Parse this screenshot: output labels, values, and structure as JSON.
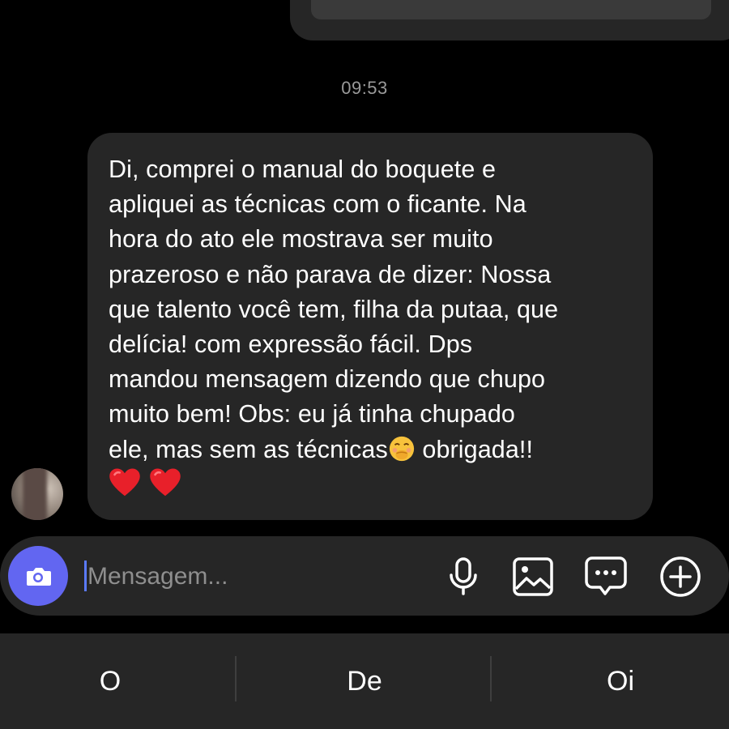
{
  "previous_message": {
    "visible_fragment": "..."
  },
  "timestamp": "09:53",
  "received_message": {
    "lines": [
      "Di, comprei o manual do boquete e",
      "apliquei as técnicas com o ficante. Na",
      "hora do ato ele mostrava ser muito",
      "prazeroso e não parava de dizer: Nossa",
      "que talento você tem, filha da putaa, que",
      "delícia!  com expressão fácil. Dps",
      "mandou mensagem dizendo que chupo",
      "muito bem! Obs: eu já tinha chupado"
    ],
    "last_line_before_emoji": "ele, mas sem as técnicas",
    "last_line_after_emoji": " obrigada!!",
    "emoji": "face-with-hand-over-mouth",
    "hearts": [
      "red-heart",
      "red-heart"
    ]
  },
  "composer": {
    "placeholder": "Mensagem...",
    "value": ""
  },
  "suggestions": [
    "O",
    "De",
    "Oi"
  ],
  "colors": {
    "background": "#000000",
    "bubble": "#262626",
    "accent": "#6266f1",
    "caret": "#5b7bff",
    "timestamp": "#9a9a9a",
    "heart": "#e8202a"
  }
}
